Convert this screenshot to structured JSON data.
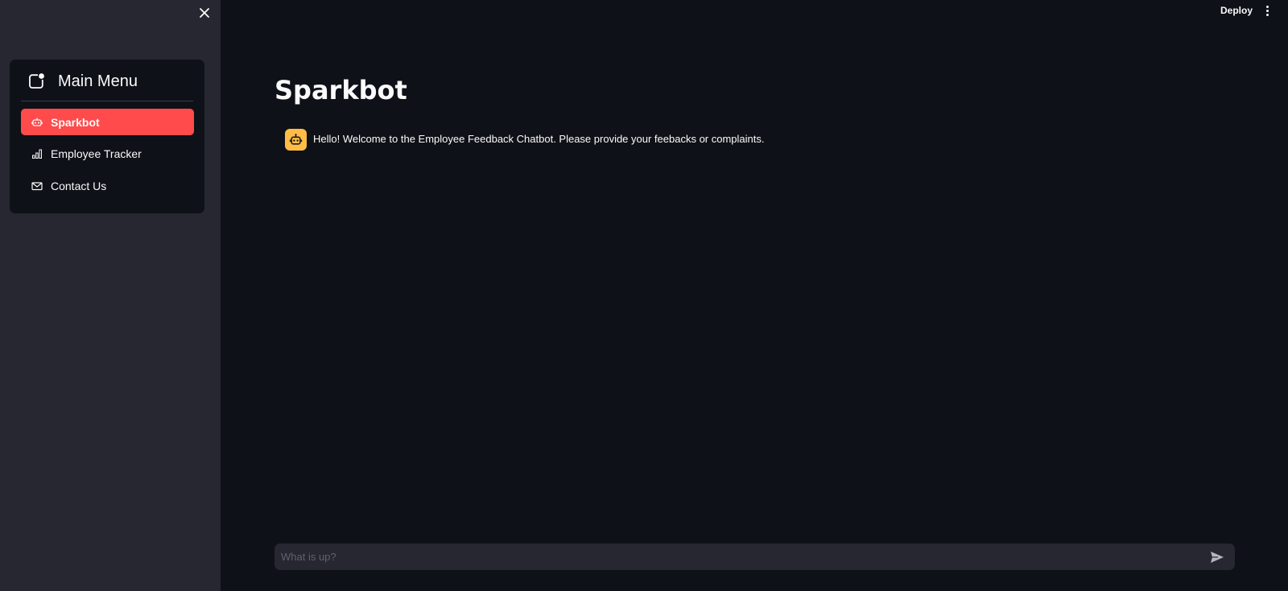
{
  "sidebar": {
    "close_icon": "close-icon",
    "menu": {
      "title": "Main Menu",
      "header_icon": "app-indicator-icon",
      "items": [
        {
          "label": "Sparkbot",
          "icon": "robot-icon",
          "active": true
        },
        {
          "label": "Employee Tracker",
          "icon": "bar-chart-icon",
          "active": false
        },
        {
          "label": "Contact Us",
          "icon": "envelope-icon",
          "active": false
        }
      ]
    }
  },
  "header": {
    "deploy_label": "Deploy",
    "menu_icon": "more-vertical-icon"
  },
  "main": {
    "title": "Sparkbot",
    "messages": [
      {
        "role": "assistant",
        "avatar_icon": "robot-icon",
        "text": "Hello! Welcome to the Employee Feedback Chatbot. Please provide your feebacks or complaints."
      }
    ],
    "chat_input": {
      "placeholder": "What is up?",
      "value": "",
      "send_icon": "send-icon"
    }
  },
  "colors": {
    "background": "#0e1117",
    "sidebar": "#262730",
    "accent": "#ff4b4b",
    "avatar": "#ffbd45",
    "text": "#fafafa"
  }
}
